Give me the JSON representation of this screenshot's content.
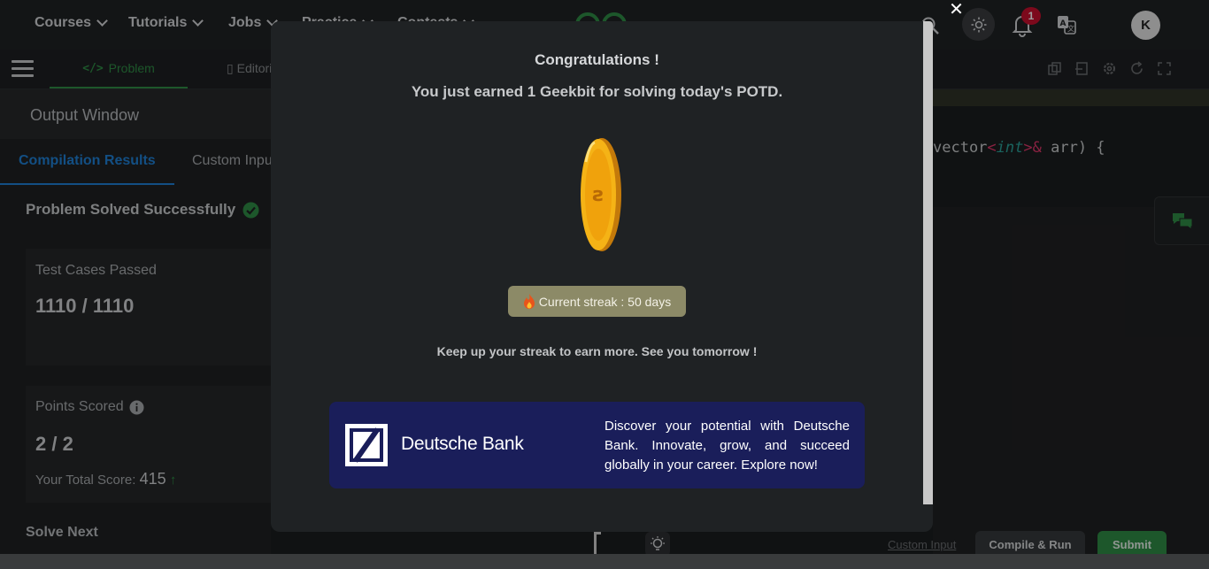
{
  "nav": {
    "items": [
      {
        "label": "Courses"
      },
      {
        "label": "Tutorials"
      },
      {
        "label": "Jobs"
      },
      {
        "label": "Practice"
      },
      {
        "label": "Contests"
      }
    ],
    "notification_count": "1",
    "avatar_initial": "K"
  },
  "subbar": {
    "tab_problem": "Problem",
    "tab_editorial": "Editorial"
  },
  "output": {
    "title": "Output Window",
    "tabs": [
      "Compilation Results",
      "Custom Input"
    ],
    "status": "Problem Solved Successfully",
    "test_cases_label": "Test Cases Passed",
    "test_cases_value": "1110 / 1110",
    "points_label": "Points Scored",
    "points_value": "2 / 2",
    "total_label": "Your Total Score:",
    "total_value": "415",
    "solve_next": "Solve Next"
  },
  "editor": {
    "code_prefix": "vector",
    "code_type": "int",
    "code_suffix": " arr) {"
  },
  "bottom": {
    "custom_input": "Custom Input",
    "compile_run": "Compile & Run",
    "submit": "Submit"
  },
  "modal": {
    "close": "✕",
    "title": "Congratulations !",
    "subtitle": "You just earned 1 Geekbit for solving today's POTD.",
    "streak": "Current streak : 50 days",
    "keep_up": "Keep up your streak to earn more. See you tomorrow !",
    "ad_brand": "Deutsche Bank",
    "ad_text": "Discover your potential with Deutsche Bank. Innovate, grow, and succeed globally in your career. Explore now!"
  },
  "colors": {
    "accent_green": "#2f8d46",
    "link_blue": "#1f80d6",
    "badge_red": "#c8102e",
    "ad_navy": "#1a1e5a",
    "streak_bg": "#8c8a67"
  }
}
